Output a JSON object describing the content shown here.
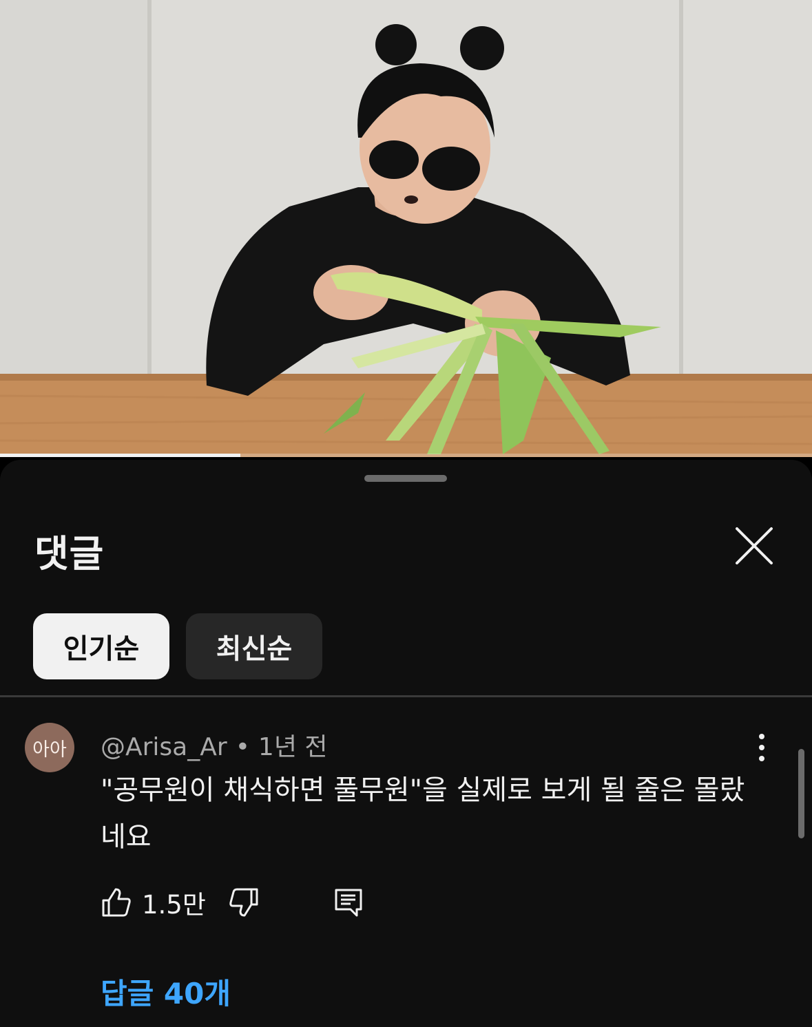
{
  "video": {
    "progress_fraction": 0.296,
    "progress_color": "#f2f2f2"
  },
  "comments_panel": {
    "title": "댓글",
    "close_icon": "close-icon",
    "sort_chips": [
      {
        "label": "인기순",
        "selected": true
      },
      {
        "label": "최신순",
        "selected": false
      }
    ]
  },
  "comment": {
    "avatar_text": "아아",
    "avatar_color": "#8d6a5c",
    "author": "@Arisa_Ar",
    "separator": "•",
    "time": "1년 전",
    "text": "\"공무원이 채식하면 풀무원\"을 실제로 보게 될 줄은 몰랐네요",
    "like_count": "1.5만",
    "replies_label": "답글 40개",
    "replies_color": "#3ea6ff",
    "icons": [
      "like-icon",
      "dislike-icon",
      "reply-icon",
      "more-icon"
    ]
  },
  "colors": {
    "sheet_background": "#0f0f0f",
    "chip_active": "#f1f1f1",
    "chip_idle": "#272727"
  }
}
